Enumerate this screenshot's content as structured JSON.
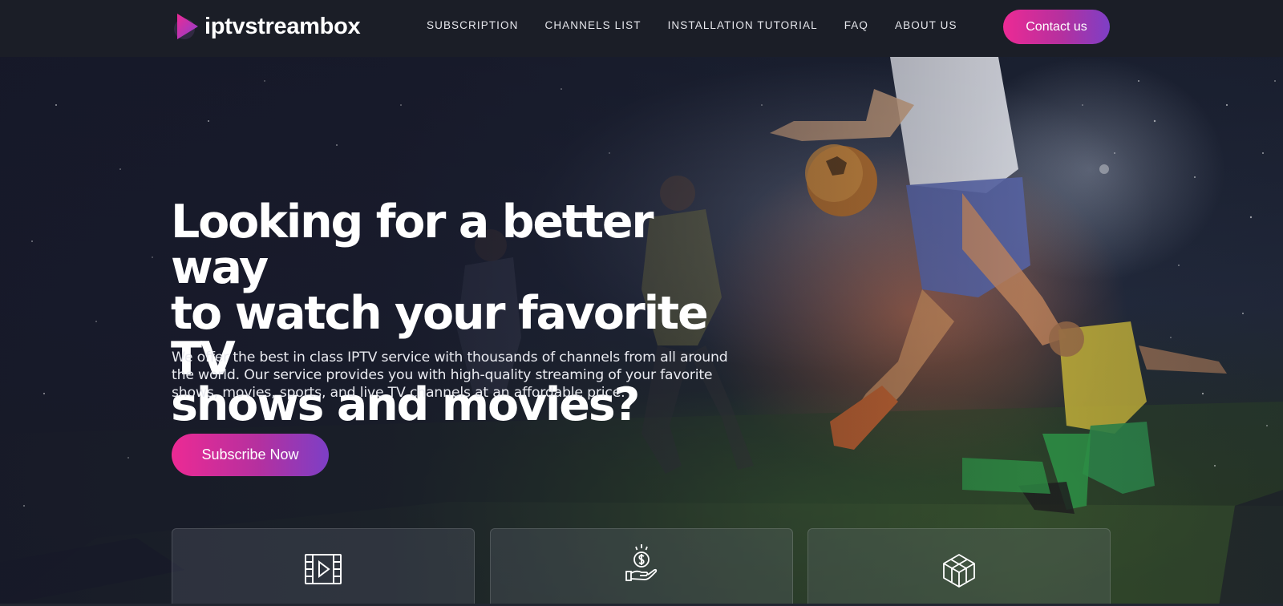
{
  "header": {
    "brand": "iptvstreambox",
    "nav": [
      {
        "label": "SUBSCRIPTION"
      },
      {
        "label": "CHANNELS LIST"
      },
      {
        "label": "INSTALLATION TUTORIAL"
      },
      {
        "label": "FAQ"
      },
      {
        "label": "ABOUT US"
      }
    ],
    "contact_label": "Contact us"
  },
  "hero": {
    "title_lines": [
      "Looking for a better way",
      "to watch your favorite TV",
      "shows and movies?"
    ],
    "description": "We offer the best in class IPTV service with thousands of channels from all around the world. Our service provides you with high-quality streaming of your favorite shows, movies, sports, and live TV channels at an affordable price.",
    "cta_label": "Subscribe Now"
  },
  "features": [
    {
      "icon": "film-icon"
    },
    {
      "icon": "money-hand-icon"
    },
    {
      "icon": "cube-icon"
    }
  ],
  "colors": {
    "header_bg": "#1b1e27",
    "accent_pink": "#ec2a94",
    "accent_purple": "#7d3fc6"
  }
}
